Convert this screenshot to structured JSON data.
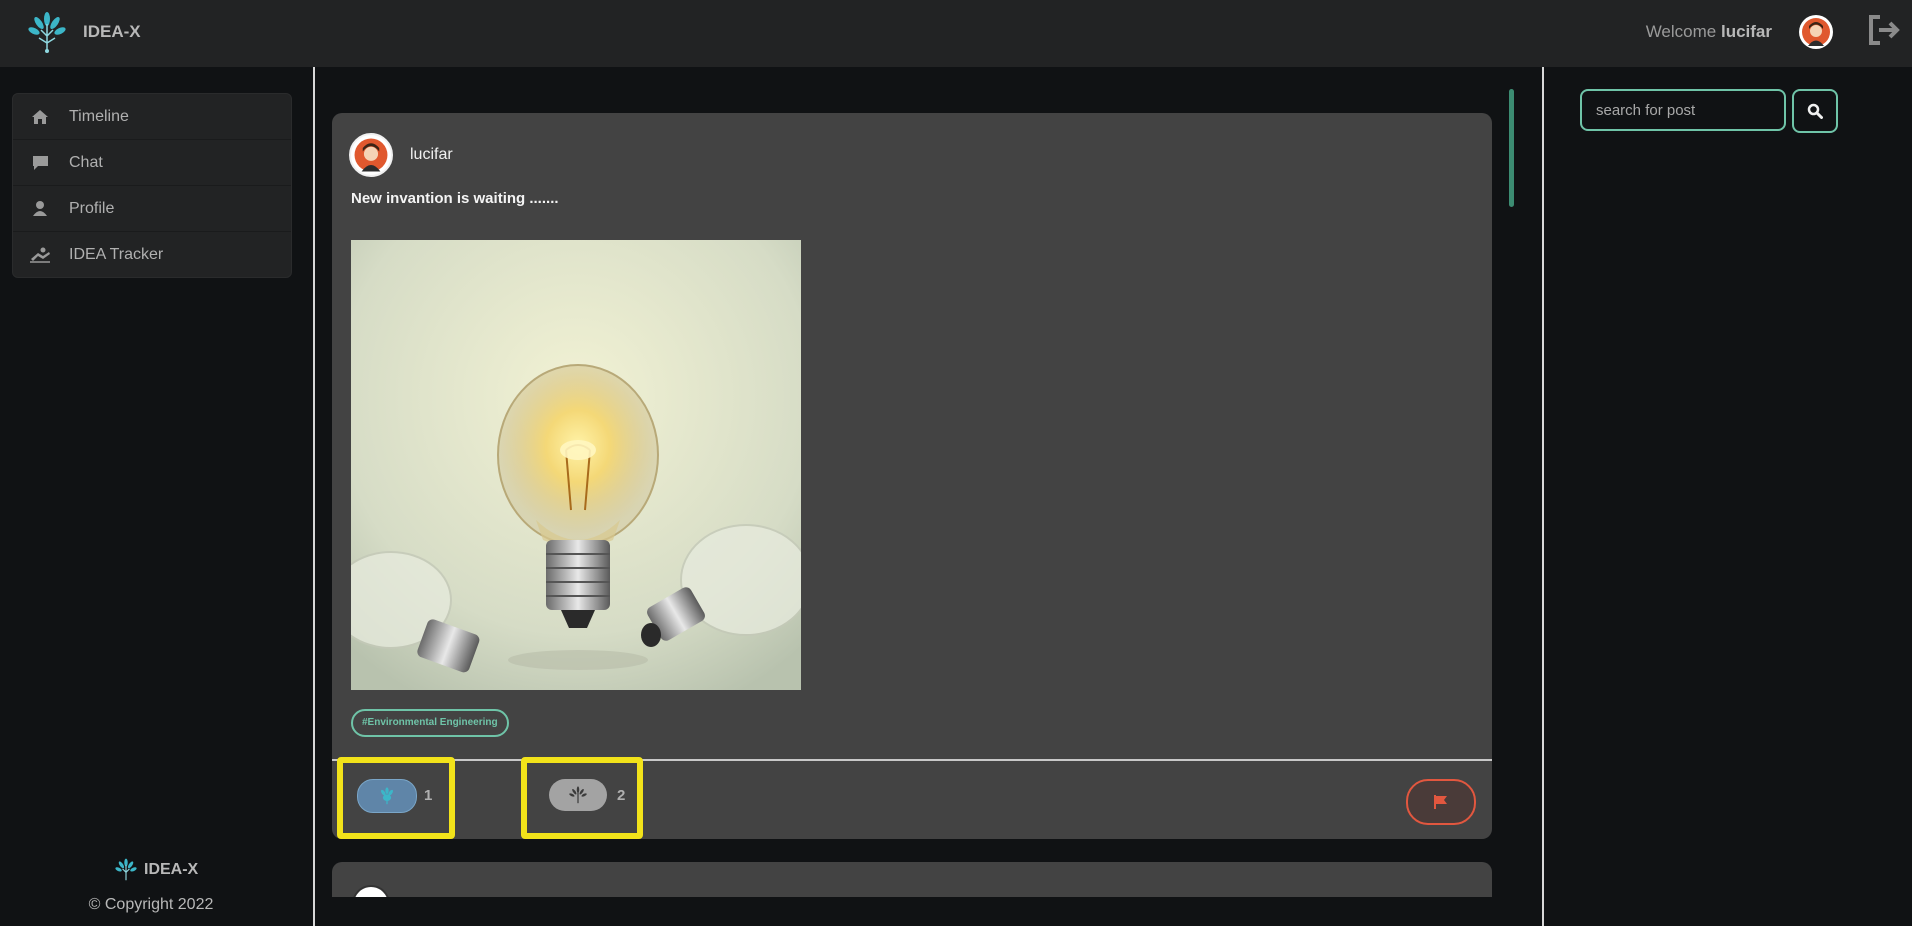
{
  "app": {
    "name": "IDEA-X"
  },
  "header": {
    "welcome_prefix": "Welcome",
    "username": "lucifar"
  },
  "sidebar": {
    "items": [
      {
        "label": "Timeline",
        "icon": "home-icon"
      },
      {
        "label": "Chat",
        "icon": "chat-icon"
      },
      {
        "label": "Profile",
        "icon": "user-icon"
      },
      {
        "label": "IDEA Tracker",
        "icon": "tracker-icon"
      }
    ],
    "footer_brand": "IDEA-X",
    "copyright": "© Copyright 2022"
  },
  "search": {
    "placeholder": "search for post"
  },
  "post": {
    "author": "lucifar",
    "text": "New invantion is waiting .......",
    "tag": "#Environmental Engineering",
    "reactions": [
      {
        "count": "1",
        "icon": "idea-tree-icon",
        "active": true
      },
      {
        "count": "2",
        "icon": "idea-tree-icon",
        "active": false
      }
    ]
  },
  "colors": {
    "accent": "#6fc4a8",
    "flag": "#e2573f",
    "highlight": "#f2e31a",
    "card": "#434343"
  }
}
